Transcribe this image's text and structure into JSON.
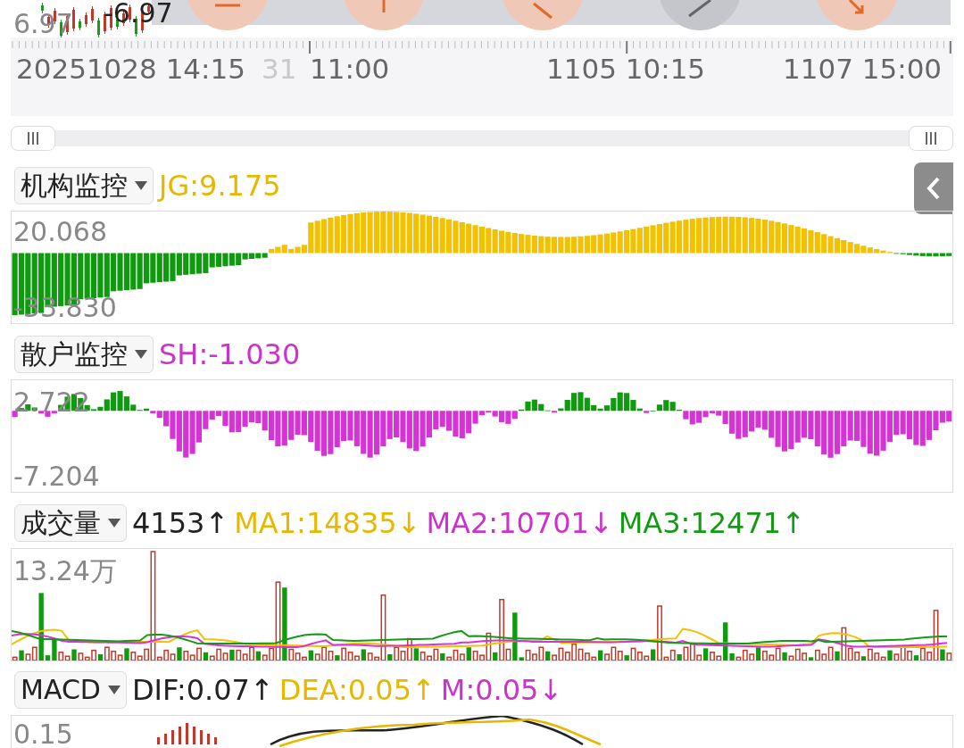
{
  "price_strip": {
    "high_label": "6.97",
    "last_label": "-6.97",
    "tool_buttons": [
      {
        "kind": "minus"
      },
      {
        "kind": "up"
      },
      {
        "kind": "diag"
      },
      {
        "kind": "slash"
      },
      {
        "kind": "down"
      }
    ]
  },
  "range_slider": {
    "handles": [
      {
        "level": 0
      },
      {
        "level": 1
      }
    ]
  },
  "time_axis": {
    "labels": [
      {
        "text": "20251028 14:15",
        "faded": false
      },
      {
        "text": "31",
        "faded": true
      },
      {
        "text": "11:00",
        "faded": false
      },
      {
        "text": "1105 10:15",
        "faded": false
      },
      {
        "text": "1107 15:00",
        "faded": false
      }
    ]
  },
  "panels": [
    {
      "kind": "jg",
      "indicator": "机构监控",
      "values": [
        {
          "text": "JG:9.175",
          "color": "#e6b800"
        }
      ],
      "max_label": "20.068",
      "min_label": "-33.830"
    },
    {
      "kind": "sh",
      "indicator": "散户监控",
      "values": [
        {
          "text": "SH:-1.030",
          "color": "#cc33cc"
        }
      ],
      "max_label": "2.722",
      "min_label": "-7.204"
    },
    {
      "kind": "vol",
      "indicator": "成交量",
      "values": [
        {
          "text": "4153↑",
          "color": "#222222"
        },
        {
          "text": "MA1:14835↓",
          "color": "#e6b800"
        },
        {
          "text": "MA2:10701↓",
          "color": "#cc33cc"
        },
        {
          "text": "MA3:12471↑",
          "color": "#159a15"
        }
      ],
      "max_label": "13.24万"
    },
    {
      "kind": "macd",
      "indicator": "MACD",
      "values": [
        {
          "text": "DIF:0.07↑",
          "color": "#222222"
        },
        {
          "text": "DEA:0.05↑",
          "color": "#e6b800"
        },
        {
          "text": "M:0.05↓",
          "color": "#cc33cc"
        }
      ],
      "max_label": "0.15"
    }
  ]
}
